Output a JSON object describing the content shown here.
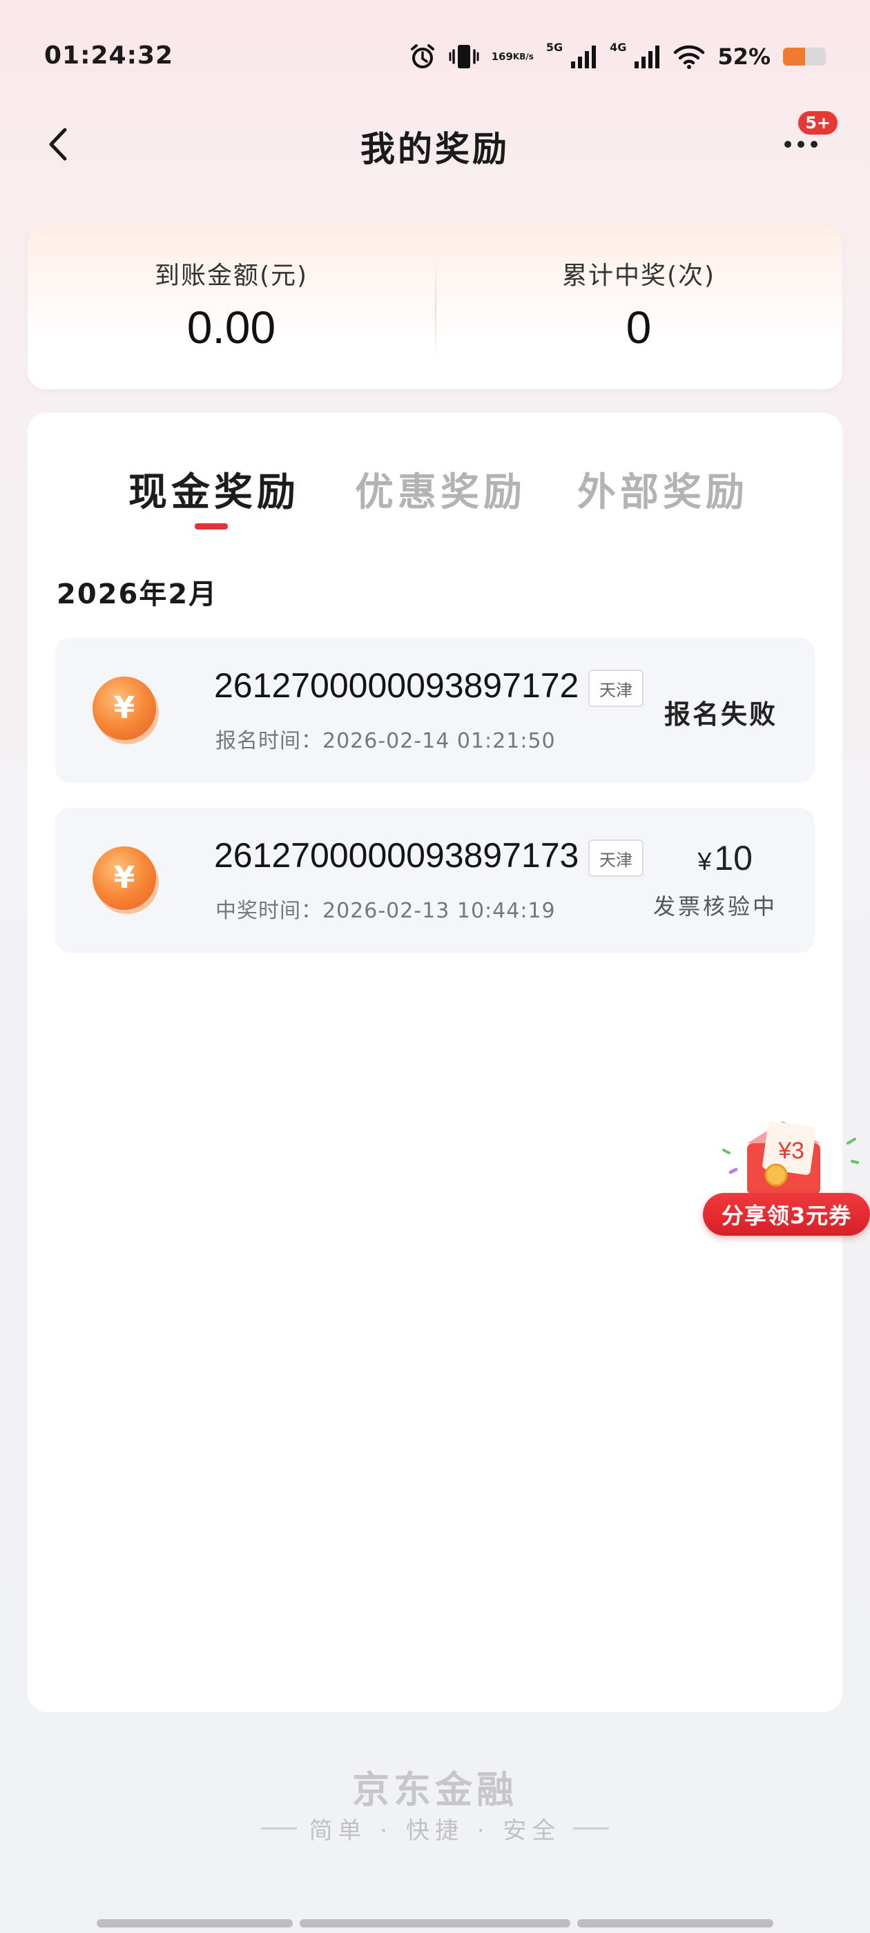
{
  "status_bar": {
    "time": "01:24:32",
    "net_speed_value": "169",
    "net_speed_unit": "KB/s",
    "sig1_label": "5G",
    "sig2_label": "4G",
    "battery_percent": "52%",
    "battery_level": 0.52
  },
  "header": {
    "title": "我的奖励",
    "badge": "5+"
  },
  "summary": {
    "amount_label": "到账金额(元)",
    "amount_value": "0.00",
    "count_label": "累计中奖(次)",
    "count_value": "0"
  },
  "tabs": [
    {
      "label": "现金奖励",
      "active": true
    },
    {
      "label": "优惠奖励",
      "active": false
    },
    {
      "label": "外部奖励",
      "active": false
    }
  ],
  "month": "2026年2月",
  "records": [
    {
      "id": "2612700000093897172",
      "tag": "天津",
      "time_label": "报名时间：",
      "time": "2026-02-14 01:21:50",
      "status": "报名失败"
    },
    {
      "id": "2612700000093897173",
      "tag": "天津",
      "time_label": "中奖时间：",
      "time": "2026-02-13 10:44:19",
      "currency": "¥",
      "amount": "10",
      "status": "发票核验中"
    }
  ],
  "promo": {
    "label": "分享领3元券",
    "coupon_text": "¥3"
  },
  "footer": {
    "brand": "京东金融",
    "slogan": "简单 · 快捷 · 安全"
  },
  "colors": {
    "accent_red": "#e0353c",
    "coin_orange": "#f5893a"
  }
}
